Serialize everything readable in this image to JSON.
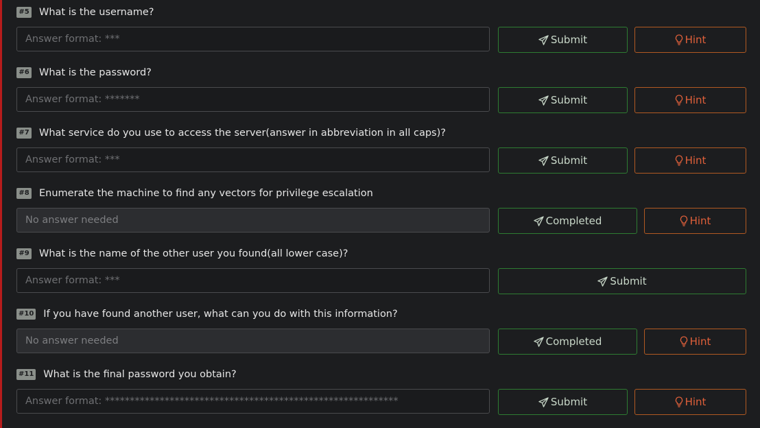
{
  "colors": {
    "accent_green": "#2e7d32",
    "accent_orange": "#b25a22",
    "edge_red": "#b71c1c",
    "background": "#1c1d1f"
  },
  "tasks": [
    {
      "num": "#5",
      "question": "What is the username?",
      "value": "Answer format: ***",
      "answer_disabled": false,
      "action": "Submit",
      "action_icon": "paper-plane-icon",
      "hint": "Hint"
    },
    {
      "num": "#6",
      "question": "What is the password?",
      "value": "Answer format: *******",
      "answer_disabled": false,
      "action": "Submit",
      "action_icon": "paper-plane-icon",
      "hint": "Hint"
    },
    {
      "num": "#7",
      "question": "What service do you use to access the server(answer in abbreviation in all caps)?",
      "value": "Answer format: ***",
      "answer_disabled": false,
      "action": "Submit",
      "action_icon": "paper-plane-icon",
      "hint": "Hint"
    },
    {
      "num": "#8",
      "question": "Enumerate the machine to find any vectors for privilege escalation",
      "value": "No answer needed",
      "answer_disabled": true,
      "action": "Completed",
      "action_icon": "paper-plane-icon",
      "hint": "Hint"
    },
    {
      "num": "#9",
      "question": "What is the name of the other user you found(all lower case)?",
      "value": "Answer format: ***",
      "answer_disabled": false,
      "action": "Submit",
      "action_icon": "paper-plane-icon",
      "hint": null
    },
    {
      "num": "#10",
      "question": "If you have found another user, what can you do with this information?",
      "value": "No answer needed",
      "answer_disabled": true,
      "action": "Completed",
      "action_icon": "paper-plane-icon",
      "hint": "Hint"
    },
    {
      "num": "#11",
      "question": "What is the final password you obtain?",
      "value": "Answer format: ***********************************************************",
      "answer_disabled": false,
      "action": "Submit",
      "action_icon": "paper-plane-icon",
      "hint": "Hint"
    }
  ]
}
